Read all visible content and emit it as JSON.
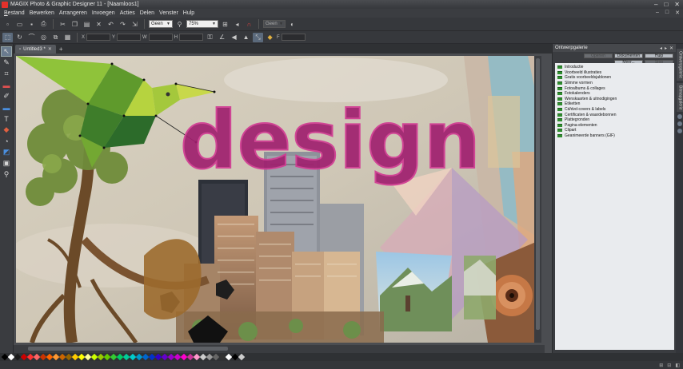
{
  "window": {
    "title": "MAGIX Photo & Graphic Designer 11 - [Naamloos1]",
    "controls": [
      "–",
      "□",
      "✕"
    ]
  },
  "menu": {
    "items": [
      "Bestand",
      "Bewerken",
      "Arrangeren",
      "Invoegen",
      "Acties",
      "Delen",
      "Venster",
      "Hulp"
    ],
    "doc_controls": [
      "–",
      "□",
      "✕"
    ]
  },
  "toolbar1": {
    "zoom_combo": "Geen",
    "zoom_percent": "75%",
    "feather_combo": "Geen"
  },
  "toolbar2": {
    "labels": [
      "W",
      "H",
      "X",
      "Y",
      "F",
      "P"
    ]
  },
  "document": {
    "tab_label": "Untitled3 *",
    "new_tab": "+"
  },
  "canvas": {
    "headline": "design"
  },
  "panel": {
    "title": "Ontwerpgalerie",
    "buttons": [
      "Openen",
      "Dokumenten",
      "Hulp",
      "Meer...",
      "Stop"
    ],
    "items": [
      "Introductie",
      "Voorbeeld illustraties",
      "Gratis voorbeeldsjablonen",
      "Slimme vormen",
      "Fotoalbums & collages",
      "Fotokalenders",
      "Wenskaarten & uitnodigingen",
      "Etiketten",
      "Cd/dvd-covers & labels",
      "Certificaten & waardebonnen",
      "Plattegronden",
      "Pagina-elementen",
      "Clipart",
      "Geanimeerde banners (GIF)"
    ],
    "side_tabs": [
      "Ontwerpgalerie",
      "Bitmapgalerie"
    ]
  },
  "palette": {
    "colors": [
      "#000000",
      "#ffffff",
      "#1a1a1a",
      "#cc0000",
      "#ff3333",
      "#ff6666",
      "#cc3300",
      "#ff6600",
      "#ff9933",
      "#cc6600",
      "#996600",
      "#ffcc00",
      "#ffff00",
      "#ffff99",
      "#ccff00",
      "#99cc00",
      "#66cc00",
      "#33cc33",
      "#00cc66",
      "#00cc99",
      "#00cccc",
      "#0099cc",
      "#0066cc",
      "#0033cc",
      "#3300cc",
      "#6600cc",
      "#9900cc",
      "#cc00cc",
      "#ff00cc",
      "#cc3399",
      "#ff99cc",
      "#cccccc",
      "#999999",
      "#666666",
      "#333333",
      "#ffffff",
      "#000000",
      "#cccccc"
    ],
    "status_icons": [
      "⊞",
      "⊟",
      "◧"
    ]
  }
}
